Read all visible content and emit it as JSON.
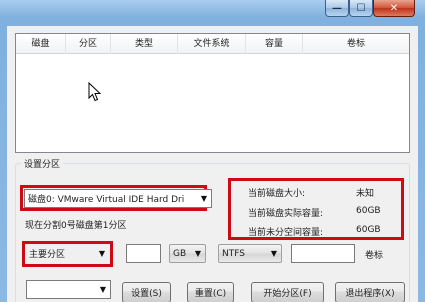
{
  "window": {
    "minimize_glyph": "—",
    "maximize_glyph": "☐",
    "close_glyph": "✕"
  },
  "list": {
    "columns": [
      "磁盘",
      "分区",
      "类型",
      "文件系统",
      "容量",
      "卷标"
    ]
  },
  "settings": {
    "group_title": "设置分区",
    "disk_combo_value": "磁盘0: VMware Virtual IDE Hard Dri",
    "current_status": "现在分割0号磁盘第1分区",
    "partition_type_value": "主要分区",
    "size_value": "",
    "unit_value": "GB",
    "filesystem_value": "NTFS",
    "volume_label_value": "",
    "volume_label_caption": "卷标",
    "bottom_combo_value": ""
  },
  "info": {
    "disk_size_label": "当前磁盘大小:",
    "disk_size_value": "未知",
    "actual_capacity_label": "当前磁盘实际容量:",
    "actual_capacity_value": "60GB",
    "unallocated_label": "当前未分空间容量:",
    "unallocated_value": "60GB"
  },
  "buttons": {
    "set": "设置(S)",
    "reset": "重置(C)",
    "start": "开始分区(F)",
    "exit": "退出程序(X)"
  },
  "colors": {
    "highlight_box": "#cc0b14"
  }
}
